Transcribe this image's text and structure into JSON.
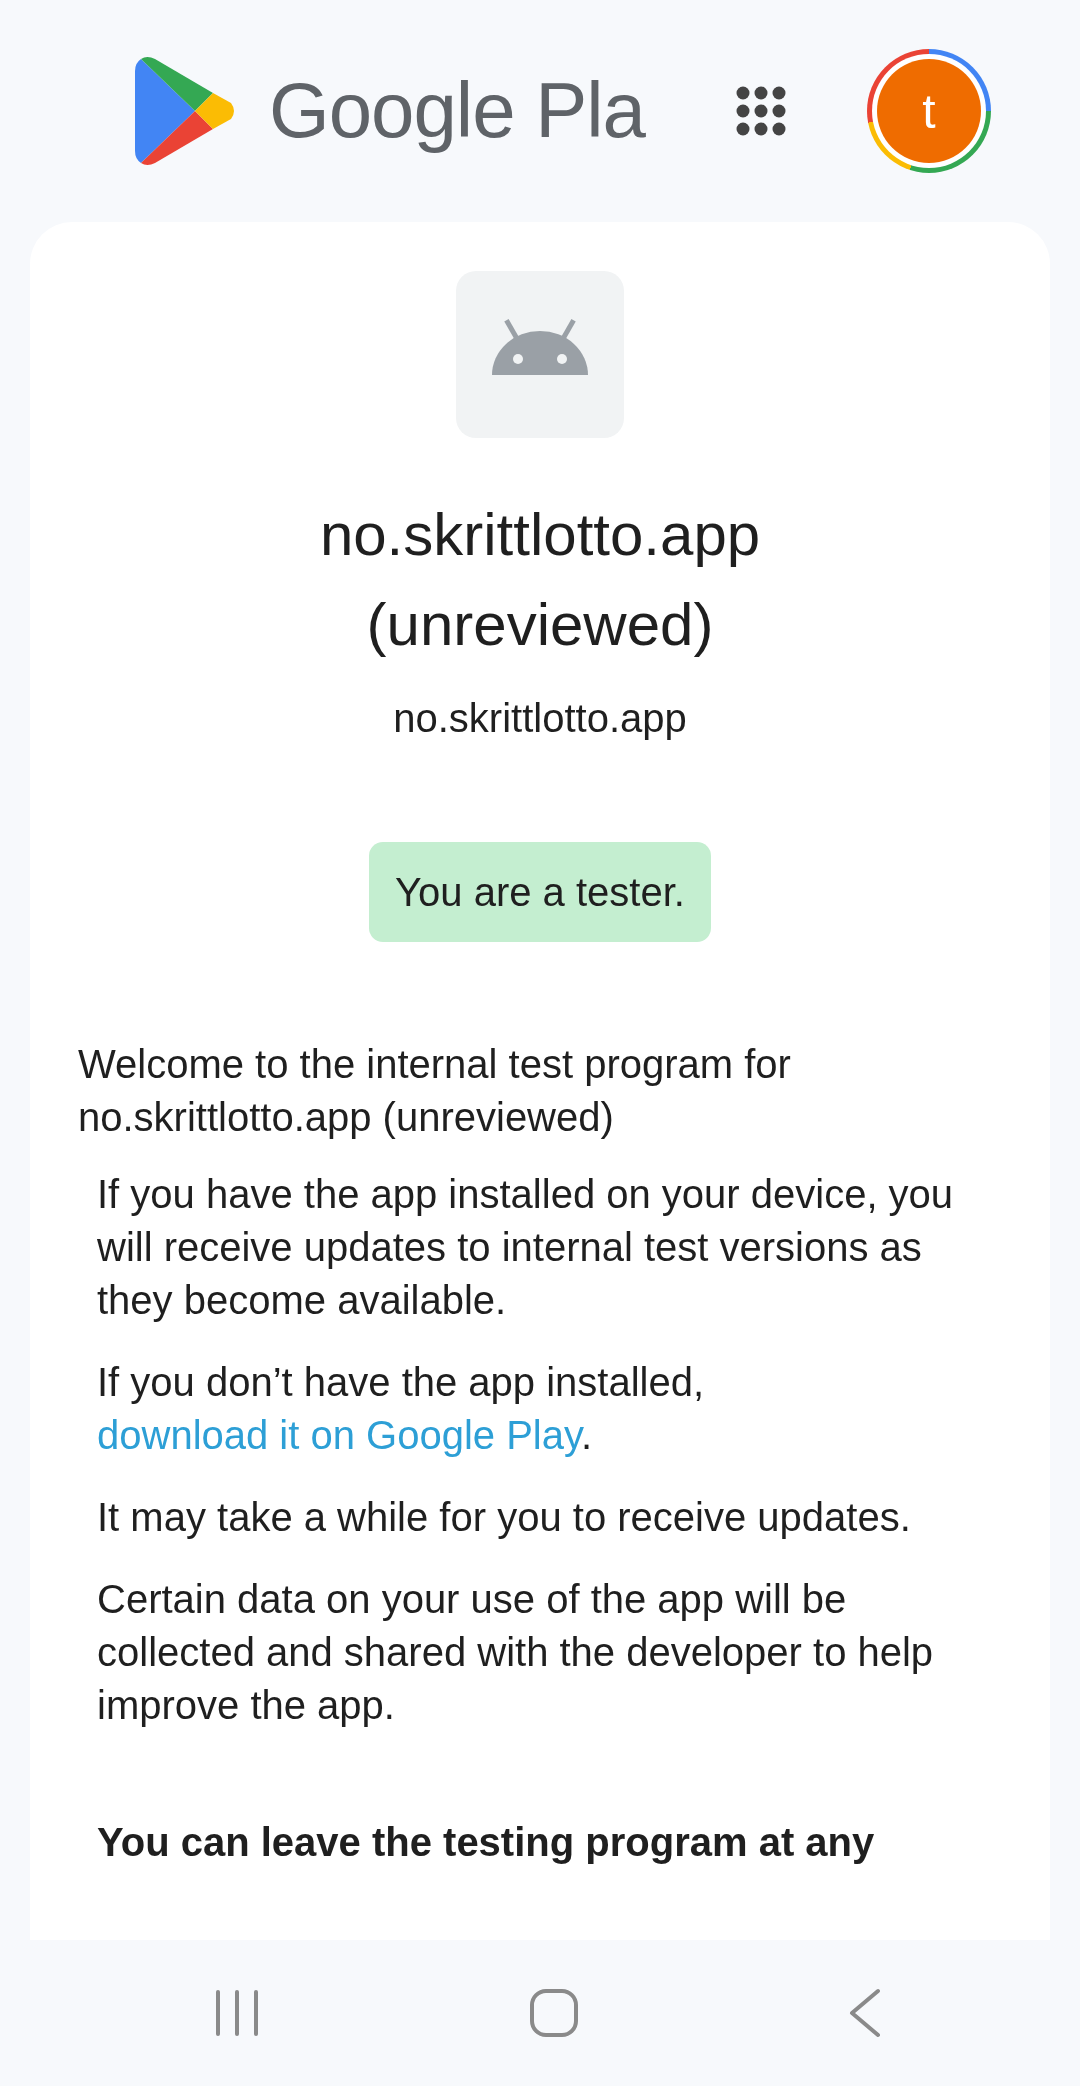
{
  "header": {
    "logo_text": "Google Pla",
    "avatar_letter": "t"
  },
  "app": {
    "title": "no.skrittlotto.app (unreviewed)",
    "package": "no.skrittlotto.app"
  },
  "tester_badge": "You are a tester.",
  "welcome": "Welcome to the internal test program for no.skrittlotto.app (unreviewed)",
  "paragraphs": [
    {
      "kind": "text",
      "text": "If you have the app installed on your device, you will receive updates to internal test versions as they become available."
    },
    {
      "kind": "link",
      "text": "If you don’t have the app installed,",
      "link": "download it on Google Play",
      "after": "."
    },
    {
      "kind": "text",
      "text": "It may take a while for you to receive updates."
    },
    {
      "kind": "text",
      "text": "Certain data on your use of the app will be collected and shared with the developer to help improve the app."
    }
  ],
  "notice": "You can leave the testing program at any"
}
